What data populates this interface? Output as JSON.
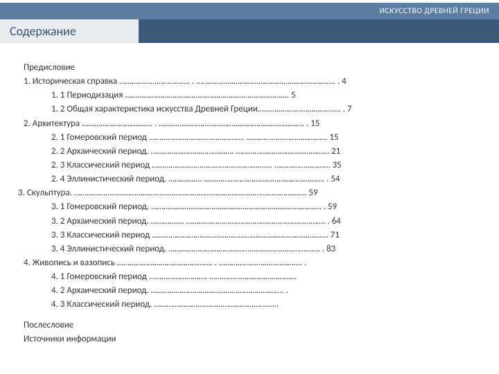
{
  "header": {
    "subject": "ИСКУССТВО ДРЕВНЕЙ ГРЕЦИИ",
    "title": "Содержание"
  },
  "toc": {
    "preface": "Предисловие",
    "e1": "1. Историческая справка ……………………………. . …………………………………………………………. . 4",
    "e1_1": "1. 1 Периодизация ……………………………………………………………………. 5",
    "e1_2": "1. 2 Общая характеристика искусства Древней Греции…………………………………. . 7",
    "e2": "2. Архитектура ……………………………. . ……………………………………………………………. . 15",
    "e2_1": "2. 1 Гомеровский период ………………………………………. ………………………………… 15",
    "e2_2": "2. 2 Архаический период. …………………………………. ……………………………………… 21",
    "e2_3": "2. 3 Классический период …………………………………………………. ……………………… 35",
    "e2_4": "2. 4 Эллинистический период. ……………. …………………………………………………. . 54",
    "e3": "3. Скульптура. …………………………………………………………………………………………………. 59",
    "e3_1": "3. 1 Гомеровский период. ………………………………………………………………………. . 59",
    "e3_2": "3. 2 Архаический период. ……………. …………………………………………………………. . 64",
    "e3_3": "3. 3 Классический период …………………………………………………………………………. 71",
    "e3_4": "3. 4 Эллинистический период. ………………………………………………………………. . 83",
    "e4": "4. Живопись и вазопись ………………………………………. . …………………………………. .",
    "e4_1": "4. 1 Гомеровский период ………………………. ……………………………………",
    "e4_2": "4. 2 Архаический период. ………………………………………………………. .",
    "e4_3": "4. 3 Классический период. ……………………………………………………"
  },
  "footer": {
    "afterword": "Послесловие",
    "sources": "Источники информации"
  }
}
